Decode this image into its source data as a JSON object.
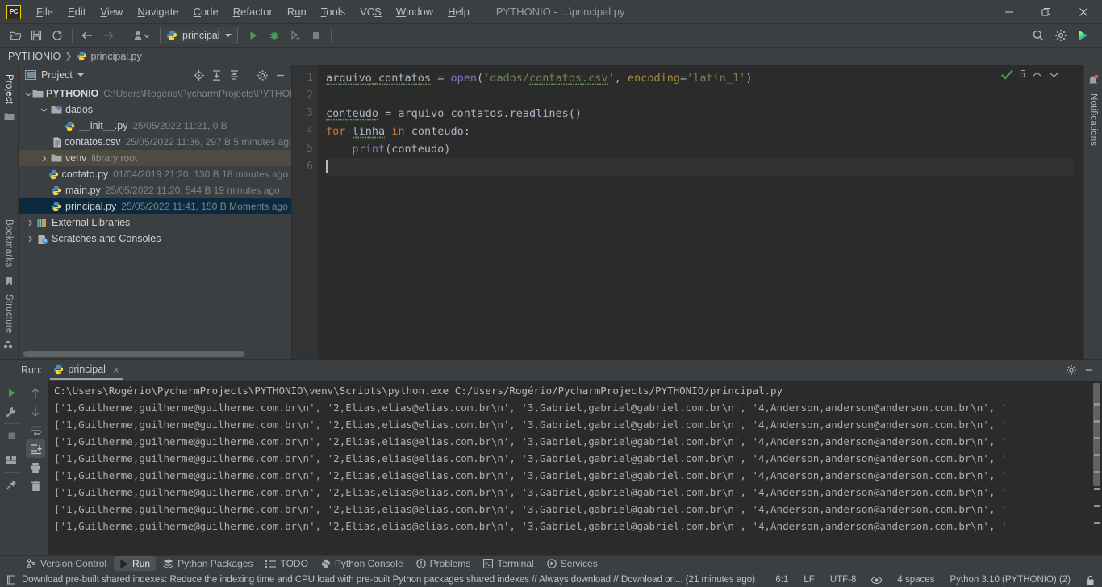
{
  "window": {
    "app_logo": "pycharm-logo",
    "title": "PYTHONIO - ...\\principal.py",
    "menus": [
      "File",
      "Edit",
      "View",
      "Navigate",
      "Code",
      "Refactor",
      "Run",
      "Tools",
      "VCS",
      "Window",
      "Help"
    ],
    "controls": {
      "minimize": "minimize-icon",
      "restore": "restore-icon",
      "close": "close-icon"
    }
  },
  "toolbar": {
    "open_label": "open-folder-icon",
    "save_label": "save-icon",
    "sync_label": "sync-icon",
    "back_label": "back-arrow-icon",
    "forward_label": "forward-arrow-icon",
    "profile_label": "user-dropdown-icon",
    "run_config": "principal",
    "run_label": "run-icon",
    "debug_label": "debug-icon",
    "run_coverage_label": "run-with-coverage-icon",
    "stop_label": "stop-icon",
    "search_label": "search-icon",
    "settings_label": "settings-gear-icon",
    "updates_label": "updates-icon"
  },
  "breadcrumb": {
    "root": "PYTHONIO",
    "separator": "❯",
    "file": "principal.py"
  },
  "left_rail": {
    "project_label": "Project",
    "bookmarks_label": "Bookmarks",
    "structure_label": "Structure"
  },
  "right_rail": {
    "notifications_label": "Notifications"
  },
  "project_panel": {
    "title": "Project",
    "icons": [
      "locate-icon",
      "expand-all-icon",
      "collapse-all-icon",
      "gear-icon",
      "hide-icon"
    ],
    "tree": [
      {
        "indent": 0,
        "arrow": "⌄",
        "icon": "folder-icon",
        "name": "PYTHONIO",
        "bold": true,
        "meta": "C:\\Users\\Rogério\\PycharmProjects\\PYTHONIO",
        "state": "normal"
      },
      {
        "indent": 1,
        "arrow": "⌄",
        "icon": "folder-source-icon",
        "name": "dados",
        "bold": false,
        "meta": "",
        "state": "normal"
      },
      {
        "indent": 2,
        "arrow": "",
        "icon": "python-file-icon",
        "name": "__init__.py",
        "bold": false,
        "meta": "25/05/2022 11:21, 0 B",
        "state": "normal"
      },
      {
        "indent": 2,
        "arrow": "",
        "icon": "csv-file-icon",
        "name": "contatos.csv",
        "bold": false,
        "meta": "25/05/2022 11:36, 297 B 5 minutes ago",
        "state": "normal"
      },
      {
        "indent": 1,
        "arrow": "›",
        "icon": "folder-icon",
        "name": "venv",
        "bold": false,
        "meta": "library root",
        "state": "highlight"
      },
      {
        "indent": 1,
        "arrow": "",
        "icon": "python-file-icon",
        "name": "contato.py",
        "bold": false,
        "meta": "01/04/2019 21:20, 130 B 18 minutes ago",
        "state": "normal"
      },
      {
        "indent": 1,
        "arrow": "",
        "icon": "python-file-icon",
        "name": "main.py",
        "bold": false,
        "meta": "25/05/2022 11:20, 544 B 19 minutes ago",
        "state": "normal"
      },
      {
        "indent": 1,
        "arrow": "",
        "icon": "python-file-icon",
        "name": "principal.py",
        "bold": false,
        "meta": "25/05/2022 11:41, 150 B Moments ago",
        "state": "selected"
      },
      {
        "indent": 0,
        "arrow": "›",
        "icon": "external-libraries-icon",
        "name": "External Libraries",
        "bold": false,
        "meta": "",
        "state": "normal"
      },
      {
        "indent": 0,
        "arrow": "›",
        "icon": "scratches-icon",
        "name": "Scratches and Consoles",
        "bold": false,
        "meta": "",
        "state": "normal"
      }
    ]
  },
  "editor": {
    "line_numbers": [
      "1",
      "2",
      "3",
      "4",
      "5",
      "6"
    ],
    "lines": [
      {
        "n": 1,
        "parts": [
          {
            "t": "arquivo_contatos",
            "c": "def",
            "squiggle": true
          },
          {
            "t": " ",
            "c": "op"
          },
          {
            "t": "=",
            "c": "op"
          },
          {
            "t": " ",
            "c": "op"
          },
          {
            "t": "open",
            "c": "fn"
          },
          {
            "t": "(",
            "c": "op"
          },
          {
            "t": "'dados/",
            "c": "str"
          },
          {
            "t": "contatos.csv",
            "c": "str",
            "squiggle": true
          },
          {
            "t": "'",
            "c": "str"
          },
          {
            "t": ", ",
            "c": "op"
          },
          {
            "t": "encoding",
            "c": "arg"
          },
          {
            "t": "=",
            "c": "op"
          },
          {
            "t": "'latin_1'",
            "c": "str"
          },
          {
            "t": ")",
            "c": "op"
          }
        ]
      },
      {
        "n": 2,
        "parts": []
      },
      {
        "n": 3,
        "parts": [
          {
            "t": "conteudo",
            "c": "def",
            "squiggle": true
          },
          {
            "t": " = ",
            "c": "op"
          },
          {
            "t": "arquivo_contatos",
            "c": "def"
          },
          {
            "t": ".readlines()",
            "c": "op"
          }
        ]
      },
      {
        "n": 4,
        "parts": [
          {
            "t": "for",
            "c": "kw"
          },
          {
            "t": " ",
            "c": "op"
          },
          {
            "t": "linha",
            "c": "def",
            "squiggle": true
          },
          {
            "t": " ",
            "c": "op"
          },
          {
            "t": "in",
            "c": "kw"
          },
          {
            "t": " ",
            "c": "op"
          },
          {
            "t": "conteudo",
            "c": "def"
          },
          {
            "t": ":",
            "c": "op"
          }
        ]
      },
      {
        "n": 5,
        "parts": [
          {
            "t": "    ",
            "c": "op"
          },
          {
            "t": "print",
            "c": "fn"
          },
          {
            "t": "(conteudo)",
            "c": "op"
          }
        ]
      },
      {
        "n": 6,
        "parts": [],
        "cursor": true
      }
    ],
    "inspection": {
      "icon": "inspection-ok-icon",
      "count": "5",
      "up": "˄",
      "down": "˅"
    }
  },
  "run_panel": {
    "label": "Run:",
    "tab": {
      "icon": "python-icon",
      "name": "principal",
      "close": "×"
    },
    "head_icons": [
      "gear-icon",
      "hide-icon"
    ],
    "toolbar_left": [
      "rerun-icon",
      "wrench-icon",
      "stop-icon",
      "layout-icon",
      "pin-icon"
    ],
    "toolbar_right": [
      "up-arrow-icon",
      "down-arrow-icon",
      "soft-wrap-icon",
      "scroll-to-end-icon",
      "print-icon",
      "trash-icon"
    ],
    "command": "C:\\Users\\Rogério\\PycharmProjects\\PYTHONIO\\venv\\Scripts\\python.exe C:/Users/Rogério/PycharmProjects/PYTHONIO/principal.py",
    "output_line": "['1,Guilherme,guilherme@guilherme.com.br\\n', '2,Elias,elias@elias.com.br\\n', '3,Gabriel,gabriel@gabriel.com.br\\n', '4,Anderson,anderson@anderson.com.br\\n', '",
    "output_repeat": 8
  },
  "tool_windows": [
    {
      "icon": "version-control-icon",
      "label": "Version Control",
      "active": false
    },
    {
      "icon": "run-icon",
      "label": "Run",
      "active": true
    },
    {
      "icon": "packages-icon",
      "label": "Python Packages",
      "active": false
    },
    {
      "icon": "todo-icon",
      "label": "TODO",
      "active": false
    },
    {
      "icon": "python-console-icon",
      "label": "Python Console",
      "active": false
    },
    {
      "icon": "problems-icon",
      "label": "Problems",
      "active": false
    },
    {
      "icon": "terminal-icon",
      "label": "Terminal",
      "active": false
    },
    {
      "icon": "services-icon",
      "label": "Services",
      "active": false
    }
  ],
  "status_bar": {
    "icon": "notification-icon",
    "message": "Download pre-built shared indexes: Reduce the indexing time and CPU load with pre-built Python packages shared indexes // Always download // Download on... (21 minutes ago)",
    "caret": "6:1",
    "line_sep": "LF",
    "encoding": "UTF-8",
    "reader_icon": "eye-icon",
    "indent": "4 spaces",
    "interpreter": "Python 3.10 (PYTHONIO) (2)",
    "lock_icon": "lock-icon"
  },
  "colors": {
    "chrome": "#3c3f41",
    "editor_bg": "#2b2b2b",
    "selection": "#0d293e",
    "highlight": "#4f4b41",
    "accent_green": "#499c54",
    "string": "#6a8759",
    "keyword": "#cc7832",
    "function": "#8a72c4",
    "text": "#a9b7c6"
  }
}
